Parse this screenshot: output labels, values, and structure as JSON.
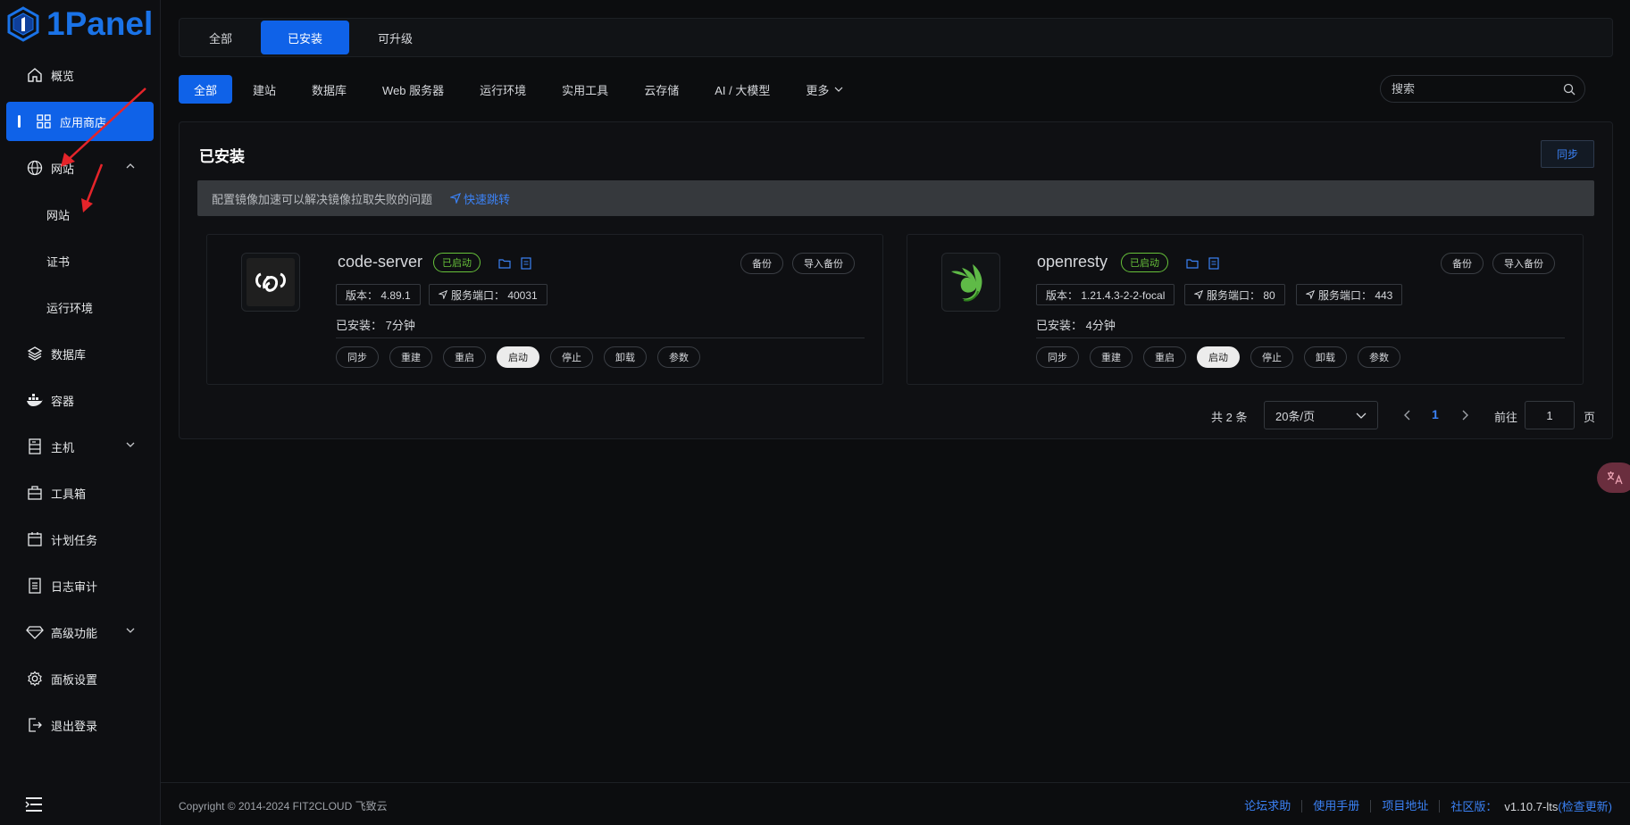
{
  "brand": {
    "name": "1Panel",
    "color": "#0f62e8"
  },
  "sidebar": {
    "items": [
      {
        "label": "概览",
        "icon": "home-icon"
      },
      {
        "label": "应用商店",
        "icon": "grid-icon",
        "active": true
      },
      {
        "label": "网站",
        "icon": "globe-icon",
        "expanded": true
      },
      {
        "label": "网站",
        "sub": true
      },
      {
        "label": "证书",
        "sub": true
      },
      {
        "label": "运行环境",
        "sub": true
      },
      {
        "label": "数据库",
        "icon": "layers-icon"
      },
      {
        "label": "容器",
        "icon": "docker-icon"
      },
      {
        "label": "主机",
        "icon": "server-icon",
        "expandable": true
      },
      {
        "label": "工具箱",
        "icon": "toolbox-icon"
      },
      {
        "label": "计划任务",
        "icon": "calendar-icon"
      },
      {
        "label": "日志审计",
        "icon": "log-icon"
      },
      {
        "label": "高级功能",
        "icon": "diamond-icon",
        "expandable": true
      },
      {
        "label": "面板设置",
        "icon": "gear-icon"
      },
      {
        "label": "退出登录",
        "icon": "logout-icon"
      }
    ]
  },
  "toptabs": [
    {
      "label": "全部"
    },
    {
      "label": "已安装",
      "active": true
    },
    {
      "label": "可升级"
    }
  ],
  "categories": [
    {
      "label": "全部",
      "active": true
    },
    {
      "label": "建站"
    },
    {
      "label": "数据库"
    },
    {
      "label": "Web 服务器"
    },
    {
      "label": "运行环境"
    },
    {
      "label": "实用工具"
    },
    {
      "label": "云存储"
    },
    {
      "label": "AI / 大模型"
    },
    {
      "label": "更多"
    }
  ],
  "search": {
    "placeholder": "搜索"
  },
  "panel": {
    "title": "已安装",
    "sync_label": "同步",
    "alert_text": "配置镜像加速可以解决镜像拉取失败的问题",
    "alert_link": "快速跳转"
  },
  "apps": [
    {
      "name": "code-server",
      "status": "已启动",
      "backup": "备份",
      "import_backup": "导入备份",
      "version": "版本：  4.89.1",
      "ports": [
        "服务端口：  40031"
      ],
      "installed": "已安装：  7分钟",
      "actions": [
        "同步",
        "重建",
        "重启",
        "启动",
        "停止",
        "卸载",
        "参数"
      ]
    },
    {
      "name": "openresty",
      "status": "已启动",
      "backup": "备份",
      "import_backup": "导入备份",
      "version": "版本：  1.21.4.3-2-2-focal",
      "ports": [
        "服务端口：  80",
        "服务端口：  443"
      ],
      "installed": "已安装：  4分钟",
      "actions": [
        "同步",
        "重建",
        "重启",
        "启动",
        "停止",
        "卸载",
        "参数"
      ]
    }
  ],
  "pagination": {
    "total": "共 2 条",
    "page_size": "20条/页",
    "current": "1",
    "goto_label": "前往",
    "goto_value": "1",
    "page_suffix": "页"
  },
  "footer": {
    "copyright": "Copyright © 2014-2024 FIT2CLOUD 飞致云",
    "links": [
      "论坛求助",
      "使用手册",
      "项目地址"
    ],
    "edition": "社区版：",
    "version": "v1.10.7-lts",
    "check_update": "(检查更新)"
  },
  "colors": {
    "accent": "#0f62e8",
    "running": "#67c23a",
    "link": "#3b82f6"
  }
}
